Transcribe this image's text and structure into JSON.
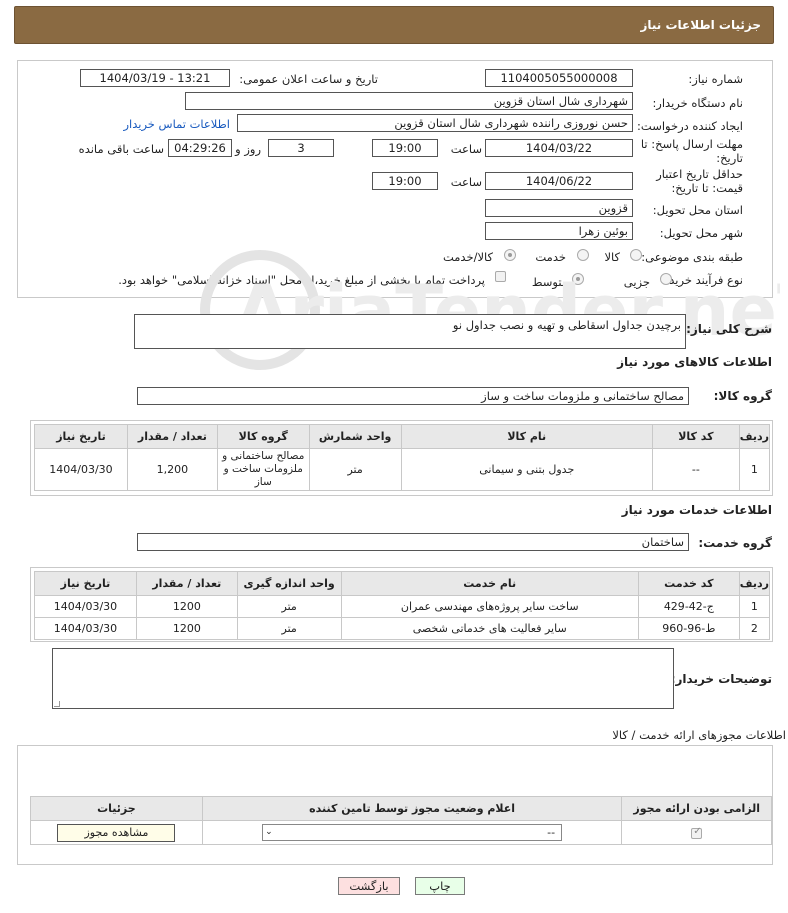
{
  "header": {
    "title": "جزئیات اطلاعات نیاز"
  },
  "form": {
    "need_number_label": "شماره نیاز:",
    "need_number": "1104005055000008",
    "announce_label": "تاریخ و ساعت اعلان عمومی:",
    "announce_value": "1404/03/19 - 13:21",
    "buyer_label": "نام دستگاه خریدار:",
    "buyer_value": "شهرداری شال استان قزوین",
    "creator_label": "ایجاد کننده درخواست:",
    "creator_value": "حسن نوروزی راننده شهرداری شال استان قزوین",
    "contact_link": "اطلاعات تماس خریدار",
    "deadline_label": "مهلت ارسال پاسخ: تا تاریخ:",
    "deadline_date": "1404/03/22",
    "time_word": "ساعت",
    "deadline_time": "19:00",
    "days_value": "3",
    "days_word": "روز و",
    "remaining_time": "04:29:26",
    "remaining_word": "ساعت باقی مانده",
    "validity_label": "حداقل تاریخ اعتبار قیمت: تا تاریخ:",
    "validity_date": "1404/06/22",
    "validity_time": "19:00",
    "province_label": "استان محل تحویل:",
    "province_value": "قزوین",
    "city_label": "شهر محل تحویل:",
    "city_value": "بوئین زهرا",
    "category_label": "طبقه بندی موضوعی:",
    "category_options": [
      "کالا",
      "خدمت",
      "کالا/خدمت"
    ],
    "process_label": "نوع فرآیند خرید :",
    "process_options": [
      "جزیی",
      "متوسط"
    ],
    "payment_note": "پرداخت تمام یا بخشی از مبلغ خرید،از محل \"اسناد خزانه اسلامی\" خواهد بود."
  },
  "description": {
    "label": "شرح کلی نیاز:",
    "value": "برچیدن جداول اسقاطی و تهیه و نصب جداول نو"
  },
  "goods": {
    "section_title": "اطلاعات کالاهای مورد نیاز",
    "group_label": "گروه کالا:",
    "group_value": "مصالح ساختمانی و ملزومات ساخت و ساز",
    "headers": [
      "ردیف",
      "کد کالا",
      "نام کالا",
      "واحد شمارش",
      "گروه کالا",
      "تعداد / مقدار",
      "تاریخ نیاز"
    ],
    "rows": [
      [
        "1",
        "--",
        "جدول بتنی و سیمانی",
        "متر",
        "مصالح ساختمانی و ملزومات ساخت و ساز",
        "1,200",
        "1404/03/30"
      ]
    ]
  },
  "services": {
    "section_title": "اطلاعات خدمات مورد نیاز",
    "group_label": "گروه خدمت:",
    "group_value": "ساختمان",
    "headers": [
      "ردیف",
      "کد خدمت",
      "نام خدمت",
      "واحد اندازه گیری",
      "تعداد / مقدار",
      "تاریخ نیاز"
    ],
    "rows": [
      [
        "1",
        "ج-42-429",
        "ساخت سایر پروژه‌های مهندسی عمران",
        "متر",
        "1200",
        "1404/03/30"
      ],
      [
        "2",
        "ط-96-960",
        "سایر فعالیت های خدماتی شخصی",
        "متر",
        "1200",
        "1404/03/30"
      ]
    ]
  },
  "buyer_notes": {
    "label": "توضیحات خریدار:",
    "value": ""
  },
  "permits": {
    "section_title": "اطلاعات مجوزهای ارائه خدمت / کالا",
    "headers": [
      "الزامی بودن ارائه مجوز",
      "اعلام وضعیت مجوز توسط تامین کننده",
      "جزئیات"
    ],
    "select_value": "--",
    "view_button": "مشاهده مجوز"
  },
  "footer": {
    "print_button": "چاپ",
    "back_button": "بازگشت"
  },
  "watermark": {
    "text": "AriaTender.neT"
  },
  "colors": {
    "header_bg": "#8a6a42",
    "link": "#1a5bbf",
    "back_btn": "#fde0e0"
  }
}
